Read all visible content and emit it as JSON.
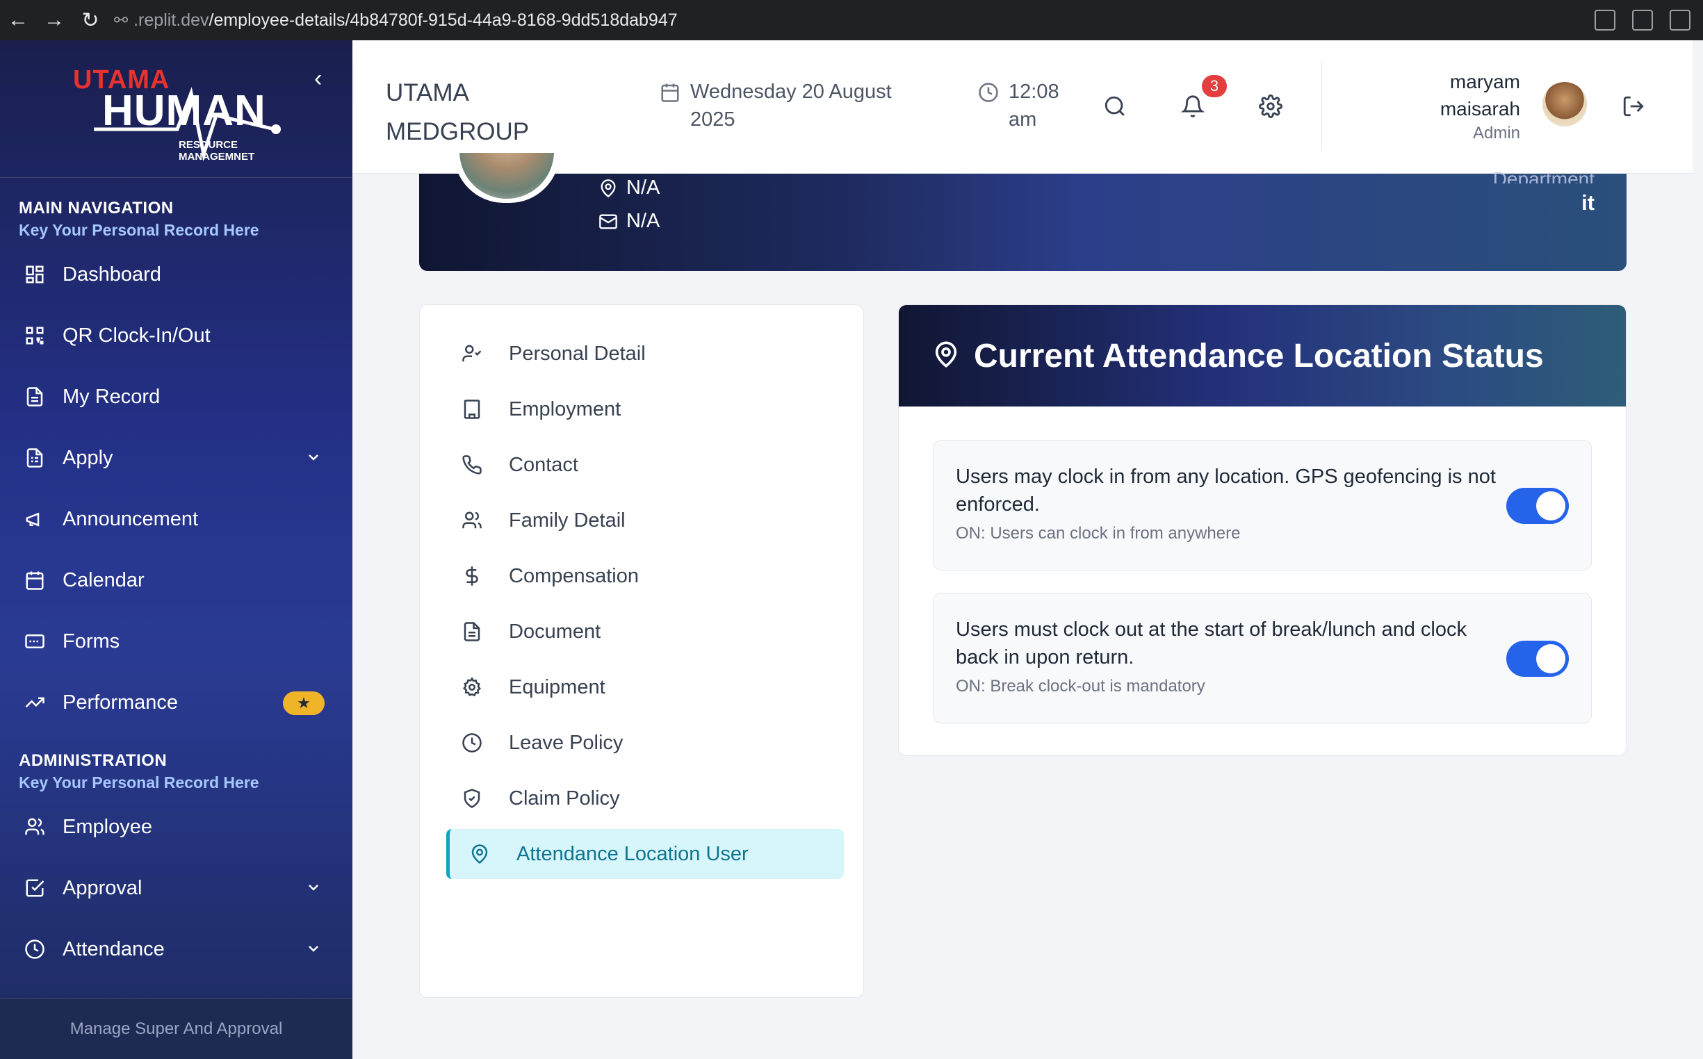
{
  "browser": {
    "url_host": ".replit.dev",
    "url_path": "/employee-details/4b84780f-915d-44a9-8168-9dd518dab947"
  },
  "logo": {
    "line1": "UTAMA",
    "line2": "HUMAN",
    "line3": "RESOURCE MANAGEMNET"
  },
  "sidebar": {
    "main_title": "MAIN NAVIGATION",
    "main_sub": "Key Your Personal Record Here",
    "main_items": [
      {
        "label": "Dashboard",
        "icon": "dashboard-icon"
      },
      {
        "label": "QR Clock-In/Out",
        "icon": "qr-icon"
      },
      {
        "label": "My Record",
        "icon": "document-icon"
      },
      {
        "label": "Apply",
        "icon": "form-icon"
      },
      {
        "label": "Announcement",
        "icon": "megaphone-icon"
      },
      {
        "label": "Calendar",
        "icon": "calendar-icon"
      },
      {
        "label": "Forms",
        "icon": "forms-icon"
      },
      {
        "label": "Performance",
        "icon": "trend-icon",
        "badge": "★"
      }
    ],
    "admin_title": "ADMINISTRATION",
    "admin_sub": "Key Your Personal Record Here",
    "admin_items": [
      {
        "label": "Employee",
        "icon": "users-icon"
      },
      {
        "label": "Approval",
        "icon": "check-square-icon"
      },
      {
        "label": "Attendance",
        "icon": "clock-icon"
      }
    ],
    "footer": "Manage Super And Approval"
  },
  "header": {
    "company": "UTAMA MEDGROUP",
    "date": "Wednesday 20 August 2025",
    "time": "12:08 am",
    "notification_count": "3",
    "user_name": "maryam maisarah",
    "user_role": "Admin"
  },
  "profile": {
    "location": "N/A",
    "email": "N/A",
    "department_label": "Department",
    "department_value": "it"
  },
  "tabs": [
    {
      "label": "Personal Detail",
      "icon": "user-check-icon"
    },
    {
      "label": "Employment",
      "icon": "building-icon"
    },
    {
      "label": "Contact",
      "icon": "phone-icon"
    },
    {
      "label": "Family Detail",
      "icon": "users-icon"
    },
    {
      "label": "Compensation",
      "icon": "dollar-icon"
    },
    {
      "label": "Document",
      "icon": "document-icon"
    },
    {
      "label": "Equipment",
      "icon": "gear-icon"
    },
    {
      "label": "Leave Policy",
      "icon": "clock-icon"
    },
    {
      "label": "Claim Policy",
      "icon": "shield-check-icon"
    },
    {
      "label": "Attendance Location User",
      "icon": "map-pin-icon",
      "active": true
    }
  ],
  "status": {
    "title": "Current Attendance Location Status",
    "options": [
      {
        "text": "Users may clock in from any location. GPS geofencing is not enforced.",
        "sub": "ON: Users can clock in from anywhere",
        "on": true
      },
      {
        "text": "Users must clock out at the start of break/lunch and clock back in upon return.",
        "sub": "ON: Break clock-out is mandatory",
        "on": true
      }
    ]
  },
  "colors": {
    "accent": "#2563eb",
    "active_tab_bg": "#d6f6fb",
    "active_tab_text": "#0e7490",
    "badge": "#e53e3e",
    "star_badge": "#f0b429"
  }
}
